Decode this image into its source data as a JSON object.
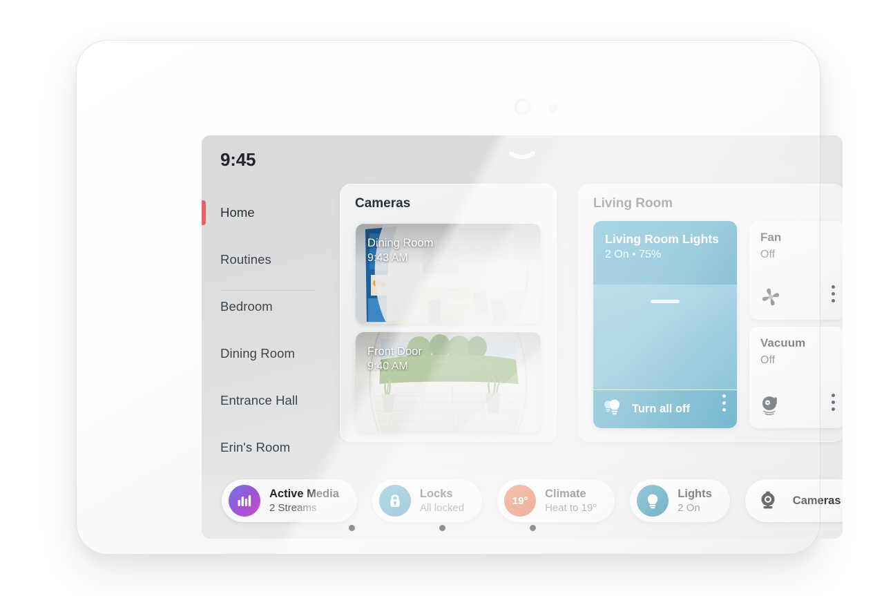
{
  "device": {
    "front_camera_icon": "front-camera-lens",
    "ambient_sensor_icon": "ambient-light-sensor"
  },
  "screen": {
    "clock": "9:45",
    "pulldown_icon": "chevron-down-icon"
  },
  "sidebar": {
    "items": [
      {
        "label": "Home",
        "selected": true
      },
      {
        "label": "Routines",
        "selected": false
      },
      {
        "label": "Bedroom",
        "selected": false
      },
      {
        "label": "Dining Room",
        "selected": false
      },
      {
        "label": "Entrance Hall",
        "selected": false
      },
      {
        "label": "Erin's Room",
        "selected": false
      }
    ],
    "active_indicator_color": "#e8606a"
  },
  "cameras_panel": {
    "title": "Cameras",
    "tiles": [
      {
        "name": "Dining Room",
        "time": "9:43 AM",
        "scene": "dining-room-fisheye"
      },
      {
        "name": "Front Door",
        "time": "9:40 AM",
        "scene": "front-door-fisheye"
      }
    ]
  },
  "living_room_panel": {
    "title": "Living Room",
    "lights": {
      "name": "Living Room Lights",
      "state": "2 On • 75%",
      "brightness_percent": 75,
      "on_count": 2,
      "accent_color": "#0f83ab",
      "turn_all_off_label": "Turn all off",
      "bulb_icon": "light-bulb-icon",
      "slider_icon": "brightness-slider",
      "kebab_icon": "more-options-icon"
    },
    "devices": [
      {
        "name": "Fan",
        "state": "Off",
        "icon": "fan-icon",
        "kebab_icon": "more-options-icon"
      },
      {
        "name": "Vacuum",
        "state": "Off",
        "icon": "robot-vacuum-icon",
        "kebab_icon": "more-options-icon"
      }
    ]
  },
  "quickbar": {
    "chips": [
      {
        "title": "Active Media",
        "sub": "2 Streams",
        "icon": "media-equalizer-icon",
        "icon_color": "#9b4fd6",
        "badge": ""
      },
      {
        "title": "Locks",
        "sub": "All locked",
        "icon": "lock-icon",
        "icon_color": "#0f83ab",
        "badge": ""
      },
      {
        "title": "Climate",
        "sub": "Heat to 19°",
        "icon": "temperature-icon",
        "icon_color": "#d9450f",
        "badge": "19°"
      },
      {
        "title": "Lights",
        "sub": "2 On",
        "icon": "light-bulb-icon",
        "icon_color": "#1a7fa4",
        "badge": ""
      },
      {
        "title": "Cameras",
        "sub": "",
        "icon": "camera-icon",
        "icon_color": "#1a1d20",
        "badge": ""
      },
      {
        "title": "",
        "sub": "",
        "icon": "partial-chip-icon",
        "icon_color": "#ffffff",
        "badge": ""
      }
    ]
  },
  "page_indicator": {
    "dots": 3,
    "active_index": 1
  }
}
